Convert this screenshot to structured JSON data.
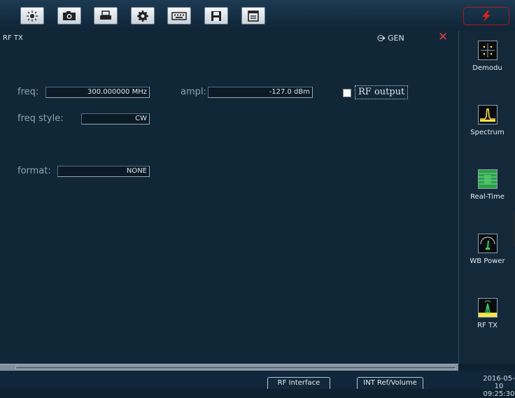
{
  "toolbar": {
    "buttons": [
      {
        "icon": "brightness-icon"
      },
      {
        "icon": "camera-icon"
      },
      {
        "icon": "print-icon"
      },
      {
        "icon": "settings-gear-icon"
      },
      {
        "icon": "keyboard-icon"
      },
      {
        "icon": "save-icon"
      },
      {
        "icon": "document-icon"
      }
    ],
    "alert_icon": "lightning-icon",
    "alert_color": "#e02020"
  },
  "panel": {
    "title": "RF TX",
    "gen_label": "GEN",
    "close_icon": "close-icon"
  },
  "form": {
    "freq_label": "freq:",
    "freq_value": "300.000000 MHz",
    "ampl_label": "ampl:",
    "ampl_value": "-127.0 dBm",
    "rf_output_label": "RF output",
    "rf_output_checked": false,
    "freq_style_label": "freq style:",
    "freq_style_value": "CW",
    "format_label": "format:",
    "format_value": "NONE"
  },
  "sidebar": {
    "items": [
      {
        "label": "Demodu",
        "icon": "demodulation-icon"
      },
      {
        "label": "Spectrum",
        "icon": "spectrum-icon"
      },
      {
        "label": "Real-Time",
        "icon": "realtime-icon"
      },
      {
        "label": "WB Power",
        "icon": "wb-power-meter-icon"
      },
      {
        "label": "RF TX",
        "icon": "rf-tx-antenna-icon"
      }
    ]
  },
  "bottom": {
    "rf_interface": "RF Interface",
    "ref_volume": "INT Ref/Volume",
    "date": "2016-05-10",
    "time": "09:25:30"
  }
}
